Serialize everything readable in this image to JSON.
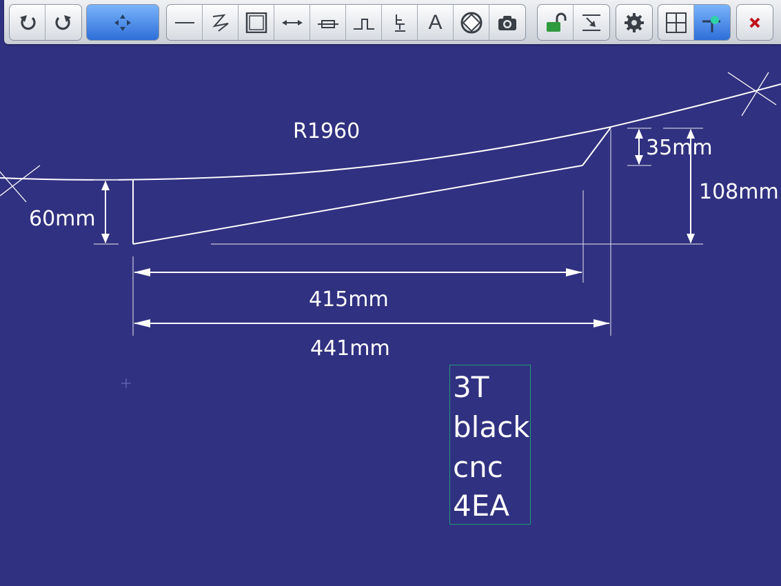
{
  "toolbar": {
    "undo": "undo-icon",
    "redo": "redo-icon",
    "move": "move-icon",
    "tools": [
      "line-tool-icon",
      "freehand-tool-icon",
      "rectangle-tool-icon",
      "dimension-tool-icon",
      "resistor-tool-icon",
      "step-tool-icon",
      "chair-tool-icon",
      "text-tool-icon",
      "lifebuoy-icon",
      "camera-icon"
    ],
    "lock": "unlock-icon",
    "import": "import-icon",
    "settings": "gear-icon",
    "grid": "grid-icon",
    "snap": "snap-icon",
    "close": "close-icon",
    "text_tool_glyph": "A",
    "accent": "#2e6fd9",
    "close_color": "#c0101a"
  },
  "drawing": {
    "radius_label": "R1960",
    "dim_60": "60mm",
    "dim_35": "35mm",
    "dim_108": "108mm",
    "dim_415": "415mm",
    "dim_441": "441mm",
    "note_lines": [
      "3T",
      "black",
      "cnc",
      "4EA"
    ],
    "background": "#313181",
    "line_color": "#ffffff",
    "note_border": "#1e9a74"
  }
}
